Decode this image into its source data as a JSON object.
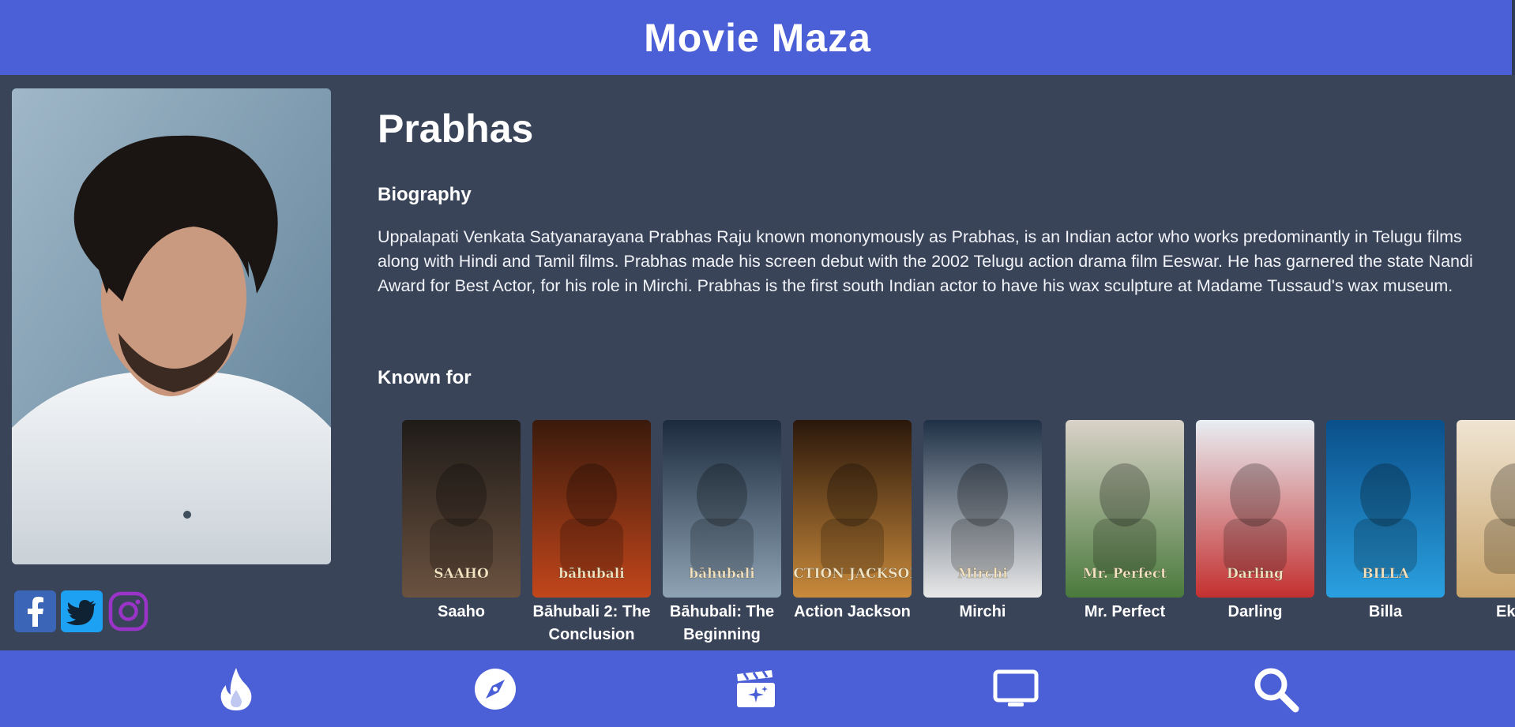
{
  "app": {
    "title": "Movie Maza"
  },
  "actor": {
    "name": "Prabhas",
    "biography_heading": "Biography",
    "biography": "Uppalapati Venkata Satyanarayana Prabhas Raju known mononymously as Prabhas, is an Indian actor who works predominantly in Telugu films along with Hindi and Tamil films. Prabhas made his screen debut with the 2002 Telugu action drama film Eeswar. He has garnered the state Nandi Award for Best Actor, for his role in Mirchi. Prabhas is the first south Indian actor to have his wax sculpture at Madame Tussaud's wax museum.",
    "known_for_heading": "Known for"
  },
  "socials": [
    {
      "icon": "facebook-icon",
      "color": "#3b66b7"
    },
    {
      "icon": "twitter-icon",
      "color": "#1da1f2"
    },
    {
      "icon": "instagram-icon",
      "color": "#9a33c7"
    }
  ],
  "known_for": [
    {
      "title": "Saaho",
      "poster_text": "SAAHO",
      "palette": [
        "#1f1b18",
        "#6b5240"
      ]
    },
    {
      "title": "Bāhubali 2: The Conclusion",
      "poster_text": "bāhubali",
      "palette": [
        "#3a1a0c",
        "#c2461b"
      ]
    },
    {
      "title": "Bāhubali: The Beginning",
      "poster_text": "bāhubali",
      "palette": [
        "#1c2b3d",
        "#8ea3b5"
      ]
    },
    {
      "title": "Action Jackson",
      "poster_text": "ACTION JACKSON",
      "palette": [
        "#2a170b",
        "#c98a3b"
      ]
    },
    {
      "title": "Mirchi",
      "poster_text": "Mirchi",
      "palette": [
        "#1f3147",
        "#e8e8e8"
      ]
    },
    {
      "title": "Mr. Perfect",
      "poster_text": "Mr. Perfect",
      "palette": [
        "#d9d2c8",
        "#4a7a3c"
      ]
    },
    {
      "title": "Darling",
      "poster_text": "Darling",
      "palette": [
        "#e8eef3",
        "#c43030"
      ]
    },
    {
      "title": "Billa",
      "poster_text": "BILLA",
      "palette": [
        "#0a4f8a",
        "#2aa0e0"
      ]
    },
    {
      "title": "Ek Ni",
      "poster_text": "",
      "palette": [
        "#efe4d2",
        "#c9a46b"
      ]
    }
  ],
  "bottom_nav": [
    {
      "icon": "flame-icon",
      "label": "Trending"
    },
    {
      "icon": "compass-icon",
      "label": "Discover"
    },
    {
      "icon": "clapperboard-icon",
      "label": "Movies"
    },
    {
      "icon": "tv-icon",
      "label": "TV"
    },
    {
      "icon": "search-icon",
      "label": "Search"
    }
  ]
}
